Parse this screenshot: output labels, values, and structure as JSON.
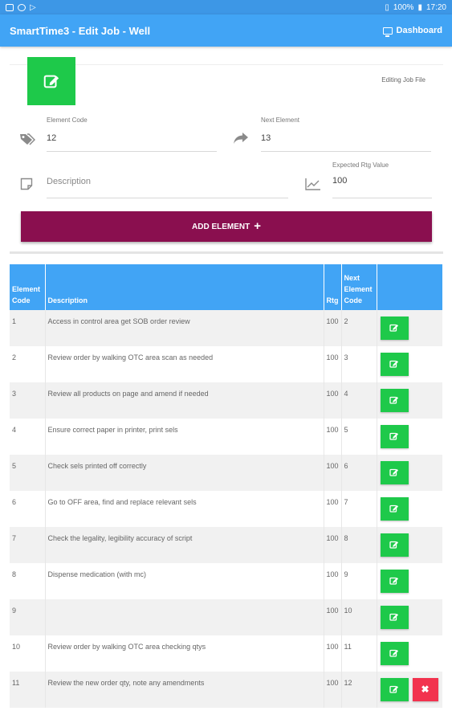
{
  "status_bar": {
    "battery": "100%",
    "time": "17:20"
  },
  "app_bar": {
    "title": "SmartTime3 - Edit Job - Well",
    "dashboard_label": "Dashboard"
  },
  "form": {
    "editing_label": "Editing Job File",
    "element_code": {
      "label": "Element Code",
      "value": "12"
    },
    "next_element": {
      "label": "Next Element",
      "value": "13"
    },
    "description": {
      "placeholder": "Description",
      "value": ""
    },
    "expected_rtg": {
      "label": "Expected Rtg Value",
      "value": "100"
    },
    "add_button_label": "ADD ELEMENT"
  },
  "table": {
    "headers": {
      "element_code": "Element Code",
      "description": "Description",
      "rtg": "Rtg",
      "next_element_code": "Next Element Code"
    },
    "rows": [
      {
        "code": "1",
        "description": "Access in control area get SOB order review",
        "rtg": "100",
        "next": "2"
      },
      {
        "code": "2",
        "description": "Review order by walking OTC area scan as needed",
        "rtg": "100",
        "next": "3"
      },
      {
        "code": "3",
        "description": "Review all products on page and amend if needed",
        "rtg": "100",
        "next": "4"
      },
      {
        "code": "4",
        "description": "Ensure correct paper in printer, print sels",
        "rtg": "100",
        "next": "5"
      },
      {
        "code": "5",
        "description": "Check sels printed off correctly",
        "rtg": "100",
        "next": "6"
      },
      {
        "code": "6",
        "description": "Go to OFF area, find and replace relevant sels",
        "rtg": "100",
        "next": "7"
      },
      {
        "code": "7",
        "description": "Check the legality, legibility accuracy of script",
        "rtg": "100",
        "next": "8"
      },
      {
        "code": "8",
        "description": "Dispense medication (with mc)",
        "rtg": "100",
        "next": "9"
      },
      {
        "code": "9",
        "description": "",
        "rtg": "100",
        "next": "10"
      },
      {
        "code": "10",
        "description": "Review order by walking OTC area checking qtys",
        "rtg": "100",
        "next": "11"
      },
      {
        "code": "11",
        "description": "Review the new order qty, note any amendments",
        "rtg": "100",
        "next": "12"
      }
    ]
  },
  "colors": {
    "app_bar": "#41a4f5",
    "status_bar": "#3d97e6",
    "add_button": "#8a0f4f",
    "edit_button": "#1ec94a",
    "delete_button": "#f2324e"
  }
}
